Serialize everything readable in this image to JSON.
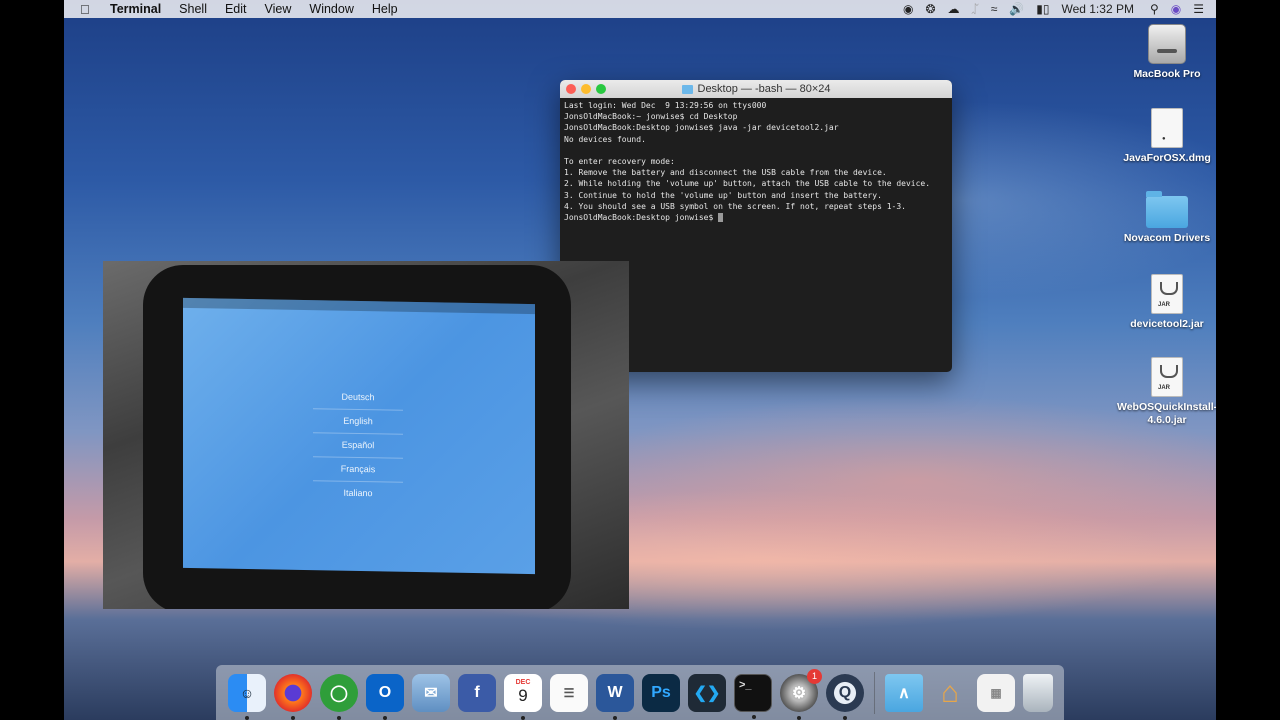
{
  "menubar": {
    "app_name": "Terminal",
    "menus": [
      "Shell",
      "Edit",
      "View",
      "Window",
      "Help"
    ],
    "clock": "Wed 1:32 PM"
  },
  "desktop_icons": [
    {
      "label": "MacBook Pro",
      "kind": "drive"
    },
    {
      "label": "JavaForOSX.dmg",
      "kind": "disk-image"
    },
    {
      "label": "Novacom Drivers",
      "kind": "folder"
    },
    {
      "label": "devicetool2.jar",
      "kind": "jar",
      "tag": "JAR"
    },
    {
      "label": "WebOSQuickInstall-4.6.0.jar",
      "kind": "jar",
      "tag": "JAR"
    }
  ],
  "terminal": {
    "title": "Desktop — -bash — 80×24",
    "lines": [
      "Last login: Wed Dec  9 13:29:56 on ttys000",
      "JonsOldMacBook:~ jonwise$ cd Desktop",
      "JonsOldMacBook:Desktop jonwise$ java -jar devicetool2.jar",
      "No devices found.",
      "",
      "To enter recovery mode:",
      "1. Remove the battery and disconnect the USB cable from the device.",
      "2. While holding the 'volume up' button, attach the USB cable to the device.",
      "3. Continue to hold the 'volume up' button and insert the battery.",
      "4. You should see a USB symbol on the screen. If not, repeat steps 1-3.",
      "JonsOldMacBook:Desktop jonwise$ "
    ]
  },
  "tablet": {
    "languages": [
      "Deutsch",
      "English",
      "Español",
      "Français",
      "Italiano"
    ]
  },
  "dock": {
    "calendar_month": "DEC",
    "calendar_day": "9",
    "preferences_badge": "1"
  }
}
